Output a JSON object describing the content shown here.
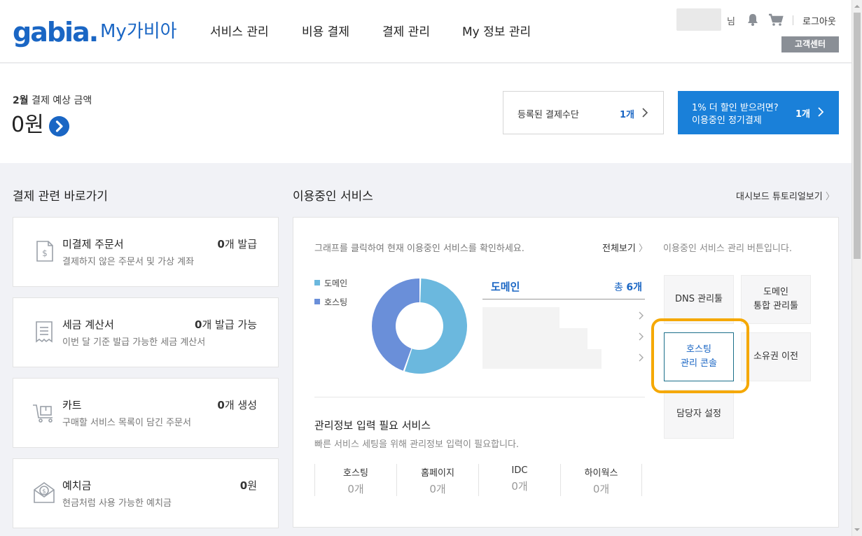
{
  "header": {
    "logo": "gabia.",
    "logo_sub": "My가비아",
    "nav": [
      "서비스 관리",
      "비용 결제",
      "결제 관리",
      "My 정보 관리"
    ],
    "user_suffix": "님",
    "logout": "로그아웃",
    "support": "고객센터"
  },
  "summary": {
    "month": "2월",
    "month_label": " 결제 예상 금액",
    "amount": "0원",
    "payment_method_label": "등록된 결제수단",
    "payment_method_count": "1개",
    "promo_line1": "1% 더 할인 받으려면?",
    "promo_line2": "이용중인 정기결제",
    "promo_count": "1개"
  },
  "shortcuts": {
    "title": "결제 관련 바로가기",
    "cards": [
      {
        "title": "미결제 주문서",
        "desc": "결제하지 않은 주문서 및 가상 계좌",
        "value_num": "0",
        "value_unit": "개 발급"
      },
      {
        "title": "세금 계산서",
        "desc": "이번 달 기준 발급 가능한 세금 계산서",
        "value_num": "0",
        "value_unit": "개 발급 가능"
      },
      {
        "title": "카트",
        "desc": "구매할 서비스 목록이 담긴 주문서",
        "value_num": "0",
        "value_unit": "개 생성"
      },
      {
        "title": "예치금",
        "desc": "현금처럼 사용 가능한 예치금",
        "value_num": "0",
        "value_unit": "원"
      }
    ]
  },
  "services": {
    "title": "이용중인 서비스",
    "tutorial_link": "대시보드 튜토리얼보기",
    "hint": "그래프를 클릭하여 현재 이용중인 서비스를 확인하세요.",
    "view_all": "전체보기",
    "legend": [
      {
        "label": "도메인",
        "color": "#6bb8de"
      },
      {
        "label": "호스팅",
        "color": "#6a8fd9"
      }
    ],
    "chart_data": {
      "type": "pie",
      "categories": [
        "도메인",
        "호스팅"
      ],
      "values": [
        55,
        45
      ],
      "colors": [
        "#6bb8de",
        "#6a8fd9"
      ]
    },
    "domain_title": "도메인",
    "domain_total_prefix": "총 ",
    "domain_total_value": "6개",
    "mgmt_title": "관리정보 입력 필요 서비스",
    "mgmt_desc": "빠른 서비스 세팅을 위해 관리정보 입력이 필요합니다.",
    "stats": [
      {
        "label": "호스팅",
        "value": "0개"
      },
      {
        "label": "홈페이지",
        "value": "0개"
      },
      {
        "label": "IDC",
        "value": "0개"
      },
      {
        "label": "하이웍스",
        "value": "0개"
      }
    ],
    "tools_hint": "이용중인 서비스 관리 버튼입니다.",
    "tools": [
      {
        "line1": "DNS 관리툴",
        "line2": ""
      },
      {
        "line1": "도메인",
        "line2": "통합 관리툴"
      },
      {
        "line1": "호스팅",
        "line2": "관리 콘솔"
      },
      {
        "line1": "소유권 이전",
        "line2": ""
      },
      {
        "line1": "담당자 설정",
        "line2": ""
      }
    ]
  }
}
